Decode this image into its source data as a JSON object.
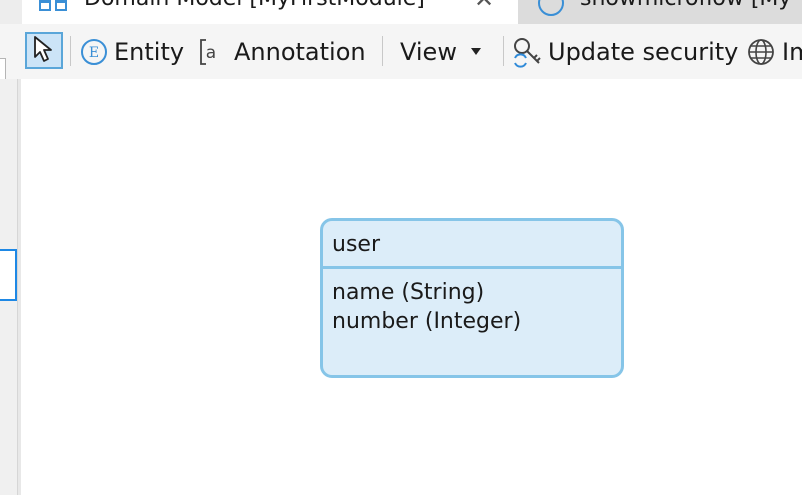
{
  "tabs": [
    {
      "label": "Domain Model [MyFirstModule]",
      "active": true,
      "icon": "domain-model-icon",
      "close": "✕"
    },
    {
      "label": "showmicroflow [My",
      "active": false,
      "icon": "microflow-icon"
    }
  ],
  "toolbar": {
    "pointer_icon": "pointer-icon",
    "entity_label": "Entity",
    "annotation_label": "Annotation",
    "view_label": "View",
    "update_security_label": "Update security",
    "last_label": "Im"
  },
  "entity": {
    "name": "user",
    "attributes": [
      {
        "text": "name (String)"
      },
      {
        "text": "number (Integer)"
      }
    ]
  },
  "colors": {
    "accent": "#1e88e5",
    "entity_fill": "#dcedf9",
    "entity_border": "#86c5e8",
    "selected_tool": "#cce4f7"
  }
}
